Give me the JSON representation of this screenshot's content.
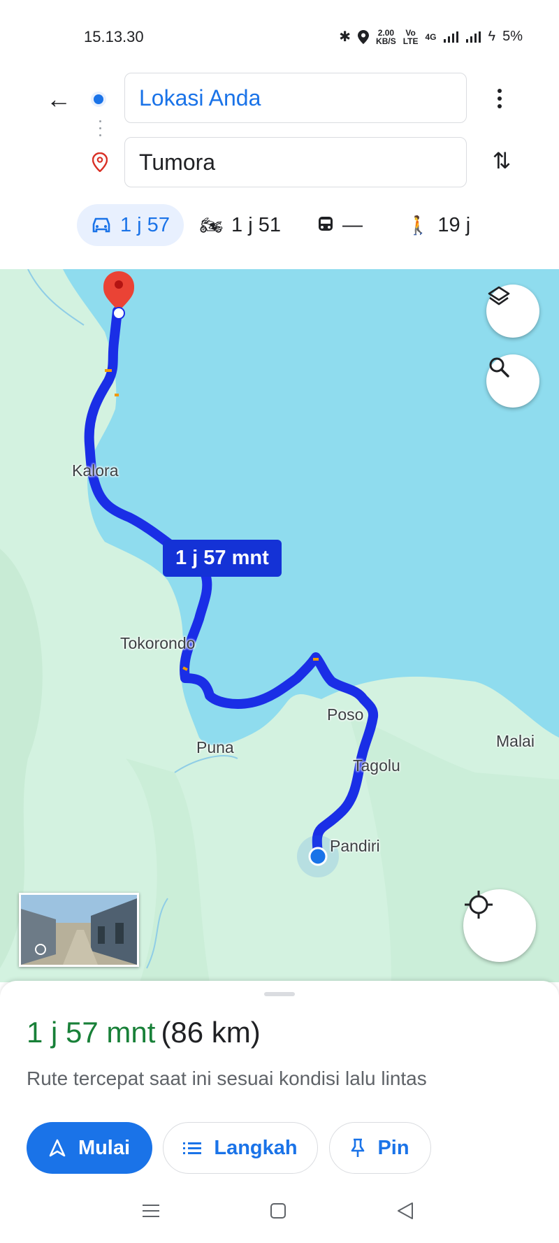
{
  "status_bar": {
    "time": "15.13.30",
    "data_rate_top": "2.00",
    "data_rate_bottom": "KB/S",
    "volte_top": "Vo",
    "volte_bottom": "LTE",
    "network": "4G",
    "battery": "5%"
  },
  "directions": {
    "origin": "Lokasi Anda",
    "destination": "Tumora"
  },
  "modes": [
    {
      "name": "car",
      "label": "1 j 57",
      "active": true
    },
    {
      "name": "motorcycle",
      "label": "1 j 51",
      "active": false
    },
    {
      "name": "transit",
      "label": "—",
      "active": false
    },
    {
      "name": "walk",
      "label": "19 j",
      "active": false
    }
  ],
  "map": {
    "route_time_label": "1 j 57 mnt",
    "places": {
      "kalora": "Kalora",
      "tokorondo": "Tokorondo",
      "puna": "Puna",
      "poso": "Poso",
      "tagolu": "Tagolu",
      "malai": "Malai",
      "pandiri": "Pandiri"
    },
    "route_color": "#1a2ee6",
    "water_color": "#8fdcee",
    "land_color": "#d3f2e0"
  },
  "sheet": {
    "duration": "1 j 57 mnt",
    "distance": "(86 km)",
    "description": "Rute tercepat saat ini sesuai kondisi lalu lintas",
    "start_label": "Mulai",
    "steps_label": "Langkah",
    "pin_label": "Pin"
  },
  "icons": {
    "back": "arrow-left",
    "more": "more-vertical",
    "swap": "swap-vertical",
    "layers": "layers",
    "search": "search",
    "locate": "crosshair",
    "street_view": "street-view"
  }
}
